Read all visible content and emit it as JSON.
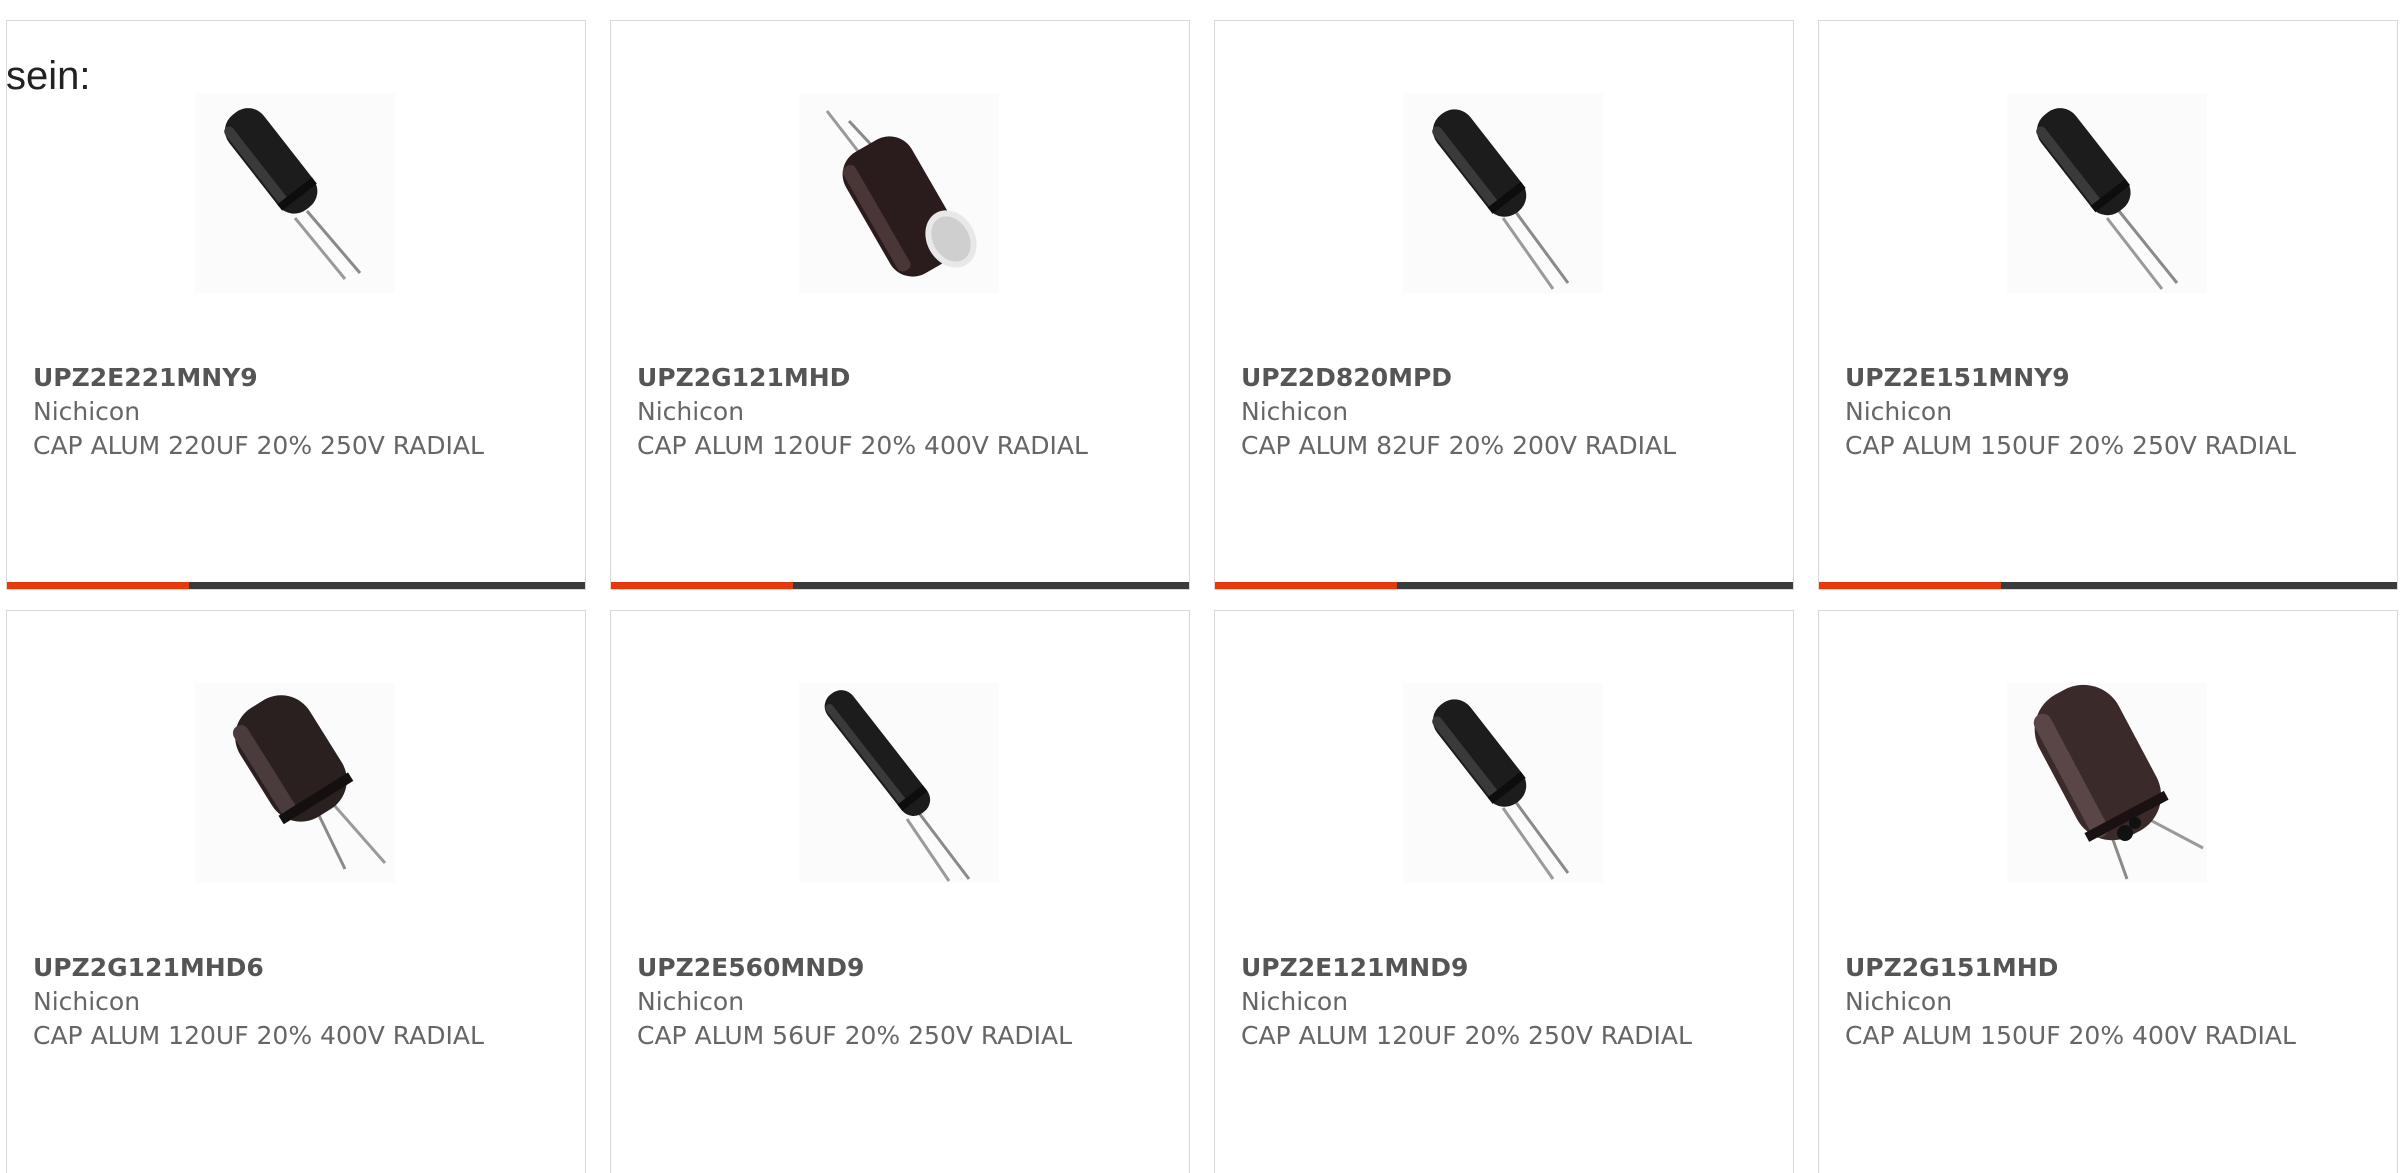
{
  "intro": {
    "text": "sein:"
  },
  "colors": {
    "accent": "#e8390e",
    "bar": "#3b3b3b",
    "border": "#d9d9d9",
    "text": "#666666"
  },
  "products": [
    {
      "part_number": "UPZ2E221MNY9",
      "manufacturer": "Nichicon",
      "description": "CAP ALUM 220UF 20% 250V RADIAL",
      "image_icon": "capacitor-slim-icon"
    },
    {
      "part_number": "UPZ2G121MHD",
      "manufacturer": "Nichicon",
      "description": "CAP ALUM 120UF 20% 400V RADIAL",
      "image_icon": "capacitor-wide-icon"
    },
    {
      "part_number": "UPZ2D820MPD",
      "manufacturer": "Nichicon",
      "description": "CAP ALUM 82UF 20% 200V RADIAL",
      "image_icon": "capacitor-slim-icon"
    },
    {
      "part_number": "UPZ2E151MNY9",
      "manufacturer": "Nichicon",
      "description": "CAP ALUM 150UF 20% 250V RADIAL",
      "image_icon": "capacitor-slim-icon"
    },
    {
      "part_number": "UPZ2G121MHD6",
      "manufacturer": "Nichicon",
      "description": "CAP ALUM 120UF 20% 400V RADIAL",
      "image_icon": "capacitor-wide-icon"
    },
    {
      "part_number": "UPZ2E560MND9",
      "manufacturer": "Nichicon",
      "description": "CAP ALUM 56UF 20% 250V RADIAL",
      "image_icon": "capacitor-long-icon"
    },
    {
      "part_number": "UPZ2E121MND9",
      "manufacturer": "Nichicon",
      "description": "CAP ALUM 120UF 20% 250V RADIAL",
      "image_icon": "capacitor-slim-icon"
    },
    {
      "part_number": "UPZ2G151MHD",
      "manufacturer": "Nichicon",
      "description": "CAP ALUM 150UF 20% 400V RADIAL",
      "image_icon": "capacitor-wide-icon"
    }
  ]
}
